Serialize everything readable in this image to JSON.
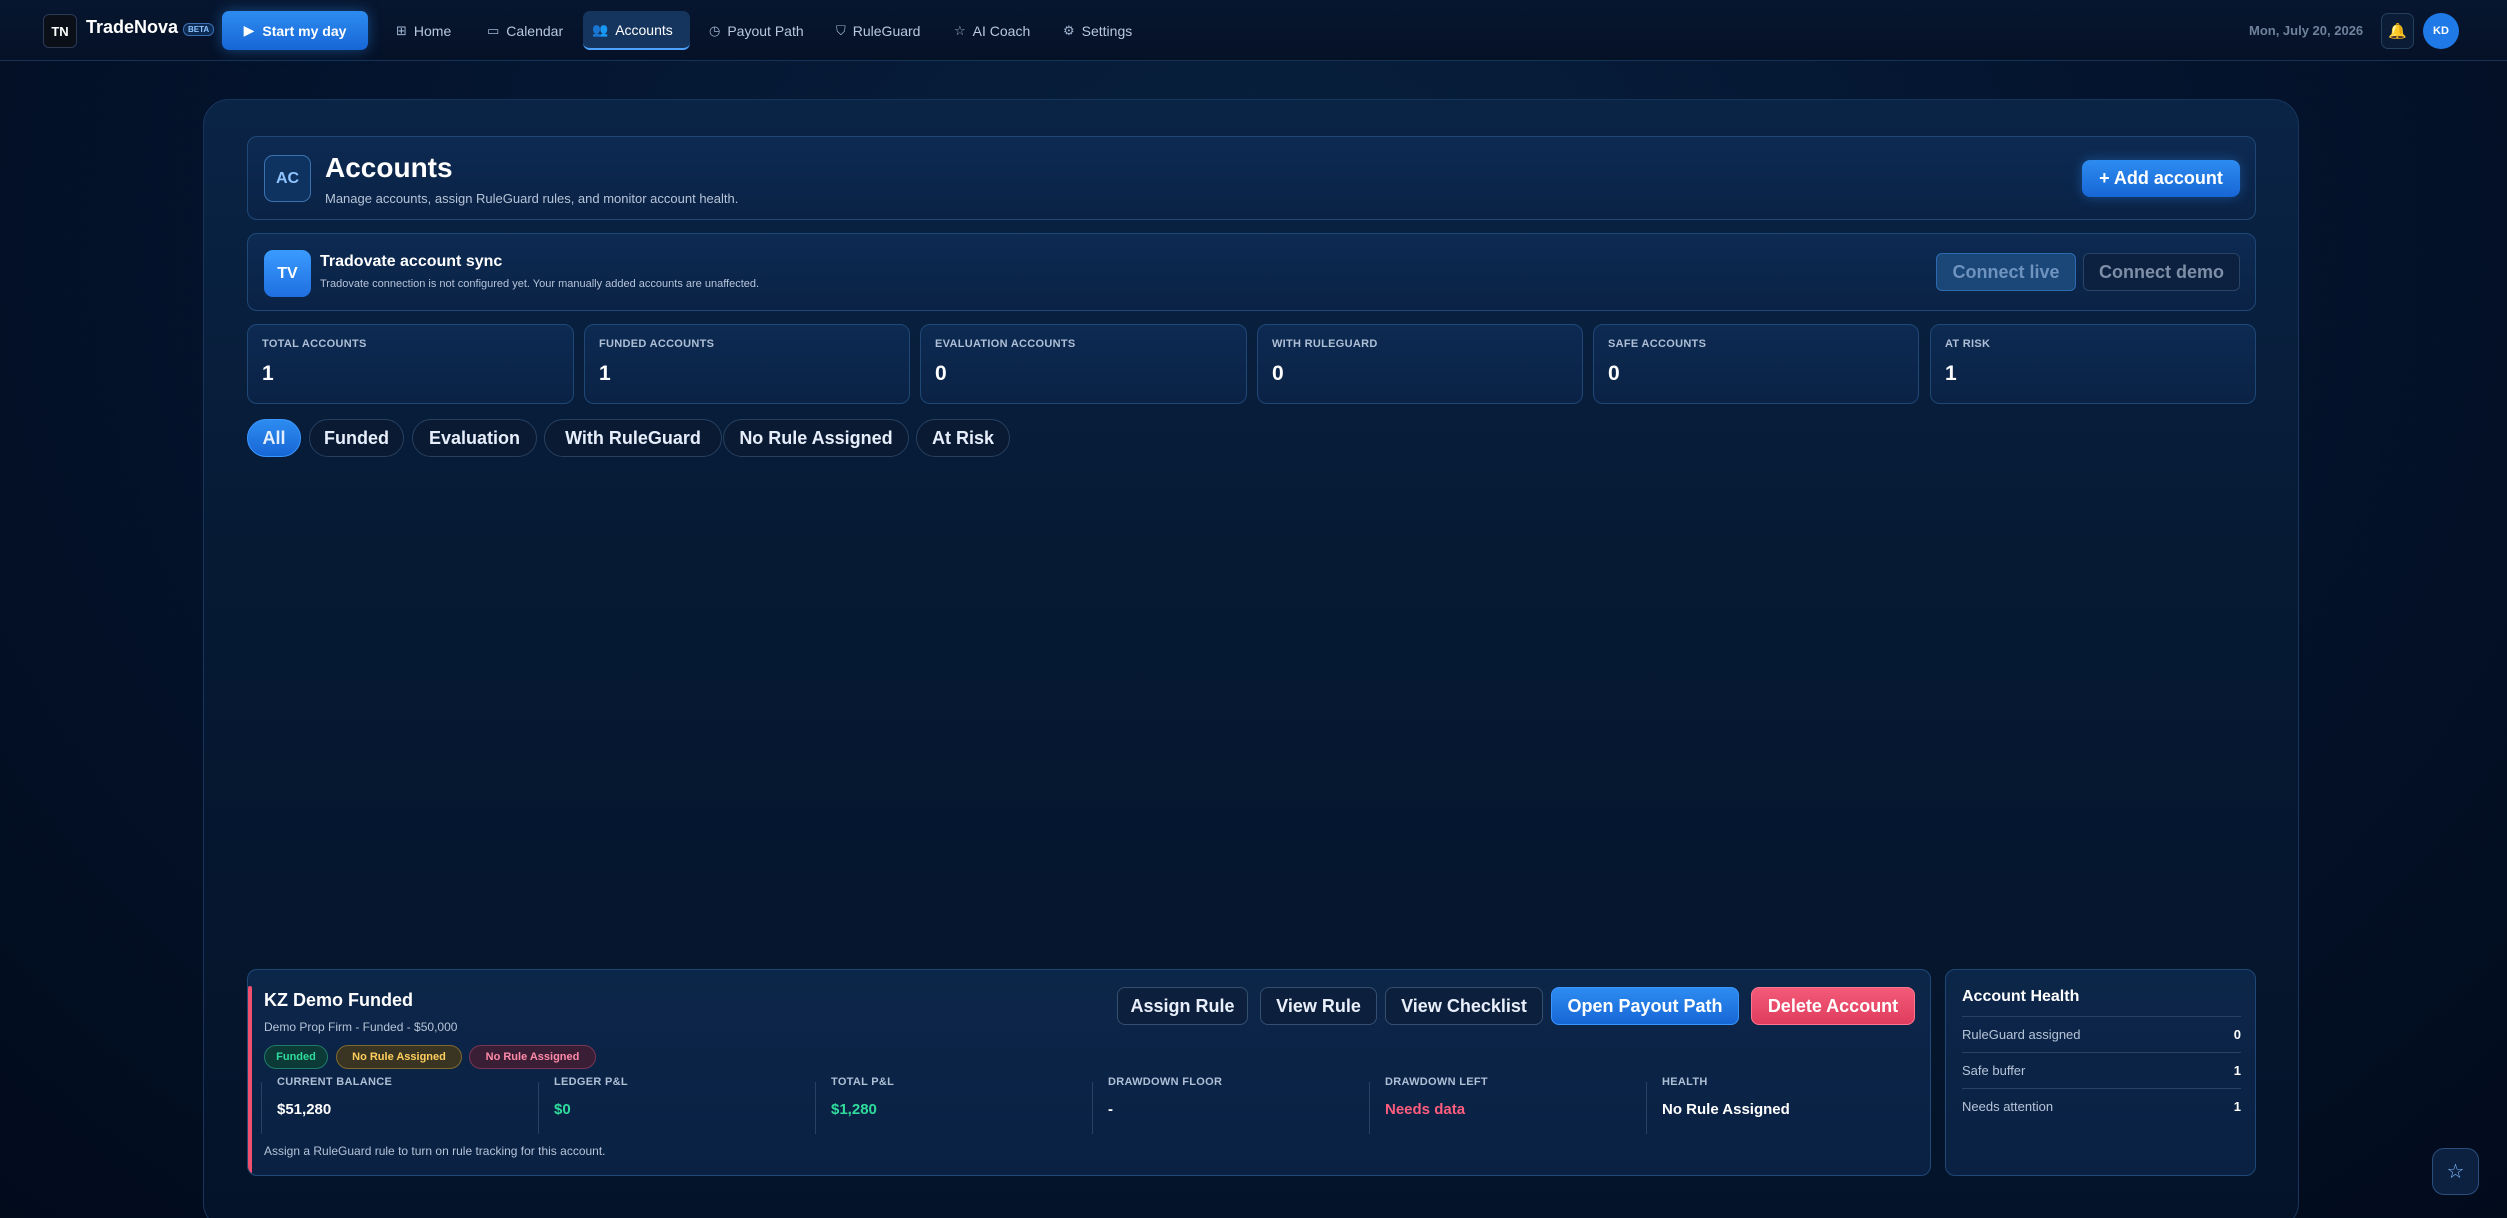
{
  "topbar": {
    "logo_text": "TN",
    "brand": "TradeNova",
    "beta": "BETA",
    "start_button": "Start my day",
    "nav": [
      {
        "label": "Home",
        "icon": "⊞"
      },
      {
        "label": "Calendar",
        "icon": "▭"
      },
      {
        "label": "Accounts",
        "icon": "👥"
      },
      {
        "label": "Payout Path",
        "icon": "◷"
      },
      {
        "label": "RuleGuard",
        "icon": "⛉"
      },
      {
        "label": "AI Coach",
        "icon": "☆"
      },
      {
        "label": "Settings",
        "icon": "⚙"
      }
    ],
    "date": "Mon, July 20, 2026",
    "avatar": "KD"
  },
  "header": {
    "icon": "AC",
    "title": "Accounts",
    "subtitle": "Manage accounts, assign RuleGuard rules, and monitor account health.",
    "add_button": "+ Add account"
  },
  "sync": {
    "icon": "TV",
    "title": "Tradovate account sync",
    "subtitle": "Tradovate connection is not configured yet. Your manually added accounts are unaffected.",
    "connect_live": "Connect live",
    "connect_demo": "Connect demo"
  },
  "stats": [
    {
      "label": "TOTAL ACCOUNTS",
      "value": "1"
    },
    {
      "label": "FUNDED ACCOUNTS",
      "value": "1"
    },
    {
      "label": "EVALUATION ACCOUNTS",
      "value": "0"
    },
    {
      "label": "WITH RULEGUARD",
      "value": "0"
    },
    {
      "label": "SAFE ACCOUNTS",
      "value": "0"
    },
    {
      "label": "AT RISK",
      "value": "1"
    }
  ],
  "filters": [
    "All",
    "Funded",
    "Evaluation",
    "With RuleGuard",
    "No Rule Assigned",
    "At Risk"
  ],
  "account": {
    "name": "KZ Demo Funded",
    "subtitle": "Demo Prop Firm - Funded - $50,000",
    "badges": [
      "Funded",
      "No Rule Assigned",
      "No Rule Assigned"
    ],
    "buttons": [
      "Assign Rule",
      "View Rule",
      "View Checklist",
      "Open Payout Path",
      "Delete Account"
    ],
    "metrics": [
      {
        "label": "CURRENT BALANCE",
        "value": "$51,280"
      },
      {
        "label": "LEDGER P&L",
        "value": "$0"
      },
      {
        "label": "TOTAL P&L",
        "value": "$1,280"
      },
      {
        "label": "DRAWDOWN FLOOR",
        "value": "-"
      },
      {
        "label": "DRAWDOWN LEFT",
        "value": "Needs data"
      },
      {
        "label": "HEALTH",
        "value": "No Rule Assigned"
      }
    ],
    "note": "Assign a RuleGuard rule to turn on rule tracking for this account."
  },
  "health": {
    "title": "Account Health",
    "rows": [
      {
        "label": "RuleGuard assigned",
        "value": "0"
      },
      {
        "label": "Safe buffer",
        "value": "1"
      },
      {
        "label": "Needs attention",
        "value": "1"
      }
    ]
  },
  "colors": {
    "accent": "#2d8cf0",
    "green": "#2fdc9b",
    "red": "#f0506e",
    "yellow": "#ffcf5c"
  }
}
